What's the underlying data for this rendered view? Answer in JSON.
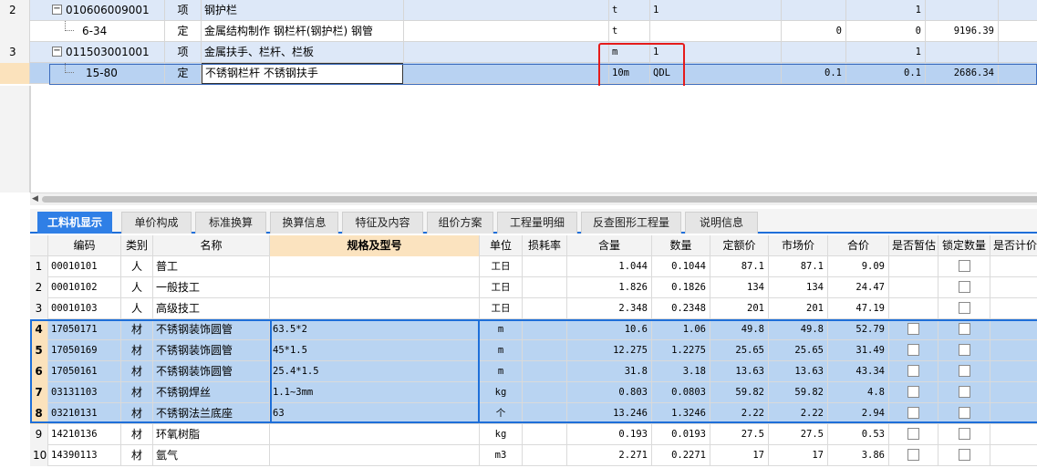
{
  "top_rows": [
    {
      "num": "2",
      "code": "010606009001",
      "expand": "−",
      "category": "项",
      "name": "钢护栏",
      "unit": "t",
      "expr": "1",
      "qty_expr": "",
      "qty": "1",
      "price": "",
      "kind": "item"
    },
    {
      "num": "",
      "code": "6-34",
      "expand": "",
      "category": "定",
      "name": "金属结构制作 钢栏杆(钢护栏) 钢管",
      "unit": "t",
      "expr": "",
      "qty_expr": "0",
      "qty": "0",
      "price": "9196.39",
      "kind": "quota"
    },
    {
      "num": "3",
      "code": "011503001001",
      "expand": "−",
      "category": "项",
      "name": "金属扶手、栏杆、栏板",
      "unit": "m",
      "expr": "1",
      "qty_expr": "",
      "qty": "1",
      "price": "",
      "kind": "item"
    },
    {
      "num": "",
      "code": "15-80",
      "expand": "",
      "category": "定",
      "name": "不锈钢栏杆 不锈钢扶手",
      "unit": "10m",
      "expr": "QDL",
      "qty_expr": "0.1",
      "qty": "0.1",
      "price": "2686.34",
      "kind": "sel"
    }
  ],
  "tabs": [
    "工料机显示",
    "单价构成",
    "标准换算",
    "换算信息",
    "特征及内容",
    "组价方案",
    "工程量明细",
    "反查图形工程量",
    "说明信息"
  ],
  "active_tab": "工料机显示",
  "columns": [
    "编码",
    "类别",
    "名称",
    "规格及型号",
    "单位",
    "损耗率",
    "含量",
    "数量",
    "定额价",
    "市场价",
    "合价",
    "是否暂估",
    "锁定数量",
    "是否计价"
  ],
  "rows": [
    {
      "num": "1",
      "code": "00010101",
      "cat": "人",
      "name": "普工",
      "spec": "",
      "unit": "工日",
      "loss": "",
      "content": "1.044",
      "qty": "0.1044",
      "quota_price": "87.1",
      "market_price": "87.1",
      "total": "9.09",
      "provisional": false,
      "locked": true
    },
    {
      "num": "2",
      "code": "00010102",
      "cat": "人",
      "name": "一般技工",
      "spec": "",
      "unit": "工日",
      "loss": "",
      "content": "1.826",
      "qty": "0.1826",
      "quota_price": "134",
      "market_price": "134",
      "total": "24.47",
      "provisional": false,
      "locked": true
    },
    {
      "num": "3",
      "code": "00010103",
      "cat": "人",
      "name": "高级技工",
      "spec": "",
      "unit": "工日",
      "loss": "",
      "content": "2.348",
      "qty": "0.2348",
      "quota_price": "201",
      "market_price": "201",
      "total": "47.19",
      "provisional": false,
      "locked": true
    },
    {
      "num": "4",
      "code": "17050171",
      "cat": "材",
      "name": "不锈钢装饰圆管",
      "spec": "63.5*2",
      "unit": "m",
      "loss": "",
      "content": "10.6",
      "qty": "1.06",
      "quota_price": "49.8",
      "market_price": "49.8",
      "total": "52.79",
      "provisional": true,
      "locked": true
    },
    {
      "num": "5",
      "code": "17050169",
      "cat": "材",
      "name": "不锈钢装饰圆管",
      "spec": "45*1.5",
      "unit": "m",
      "loss": "",
      "content": "12.275",
      "qty": "1.2275",
      "quota_price": "25.65",
      "market_price": "25.65",
      "total": "31.49",
      "provisional": true,
      "locked": true
    },
    {
      "num": "6",
      "code": "17050161",
      "cat": "材",
      "name": "不锈钢装饰圆管",
      "spec": "25.4*1.5",
      "unit": "m",
      "loss": "",
      "content": "31.8",
      "qty": "3.18",
      "quota_price": "13.63",
      "market_price": "13.63",
      "total": "43.34",
      "provisional": true,
      "locked": true
    },
    {
      "num": "7",
      "code": "03131103",
      "cat": "材",
      "name": "不锈钢焊丝",
      "spec": "1.1~3mm",
      "unit": "kg",
      "loss": "",
      "content": "0.803",
      "qty": "0.0803",
      "quota_price": "59.82",
      "market_price": "59.82",
      "total": "4.8",
      "provisional": true,
      "locked": true
    },
    {
      "num": "8",
      "code": "03210131",
      "cat": "材",
      "name": "不锈钢法兰底座",
      "spec": "63",
      "unit": "个",
      "loss": "",
      "content": "13.246",
      "qty": "1.3246",
      "quota_price": "2.22",
      "market_price": "2.22",
      "total": "2.94",
      "provisional": true,
      "locked": true
    },
    {
      "num": "9",
      "code": "14210136",
      "cat": "材",
      "name": "环氧树脂",
      "spec": "",
      "unit": "kg",
      "loss": "",
      "content": "0.193",
      "qty": "0.0193",
      "quota_price": "27.5",
      "market_price": "27.5",
      "total": "0.53",
      "provisional": true,
      "locked": true
    },
    {
      "num": "10",
      "code": "14390113",
      "cat": "材",
      "name": "氩气",
      "spec": "",
      "unit": "m3",
      "loss": "",
      "content": "2.271",
      "qty": "0.2271",
      "quota_price": "17",
      "market_price": "17",
      "total": "3.86",
      "provisional": true,
      "locked": true
    }
  ],
  "colors": {
    "accent": "#2f7fe6",
    "selection": "#b9d4f2",
    "highlight_border": "#e51b1b",
    "item_row": "#dde8f8"
  }
}
